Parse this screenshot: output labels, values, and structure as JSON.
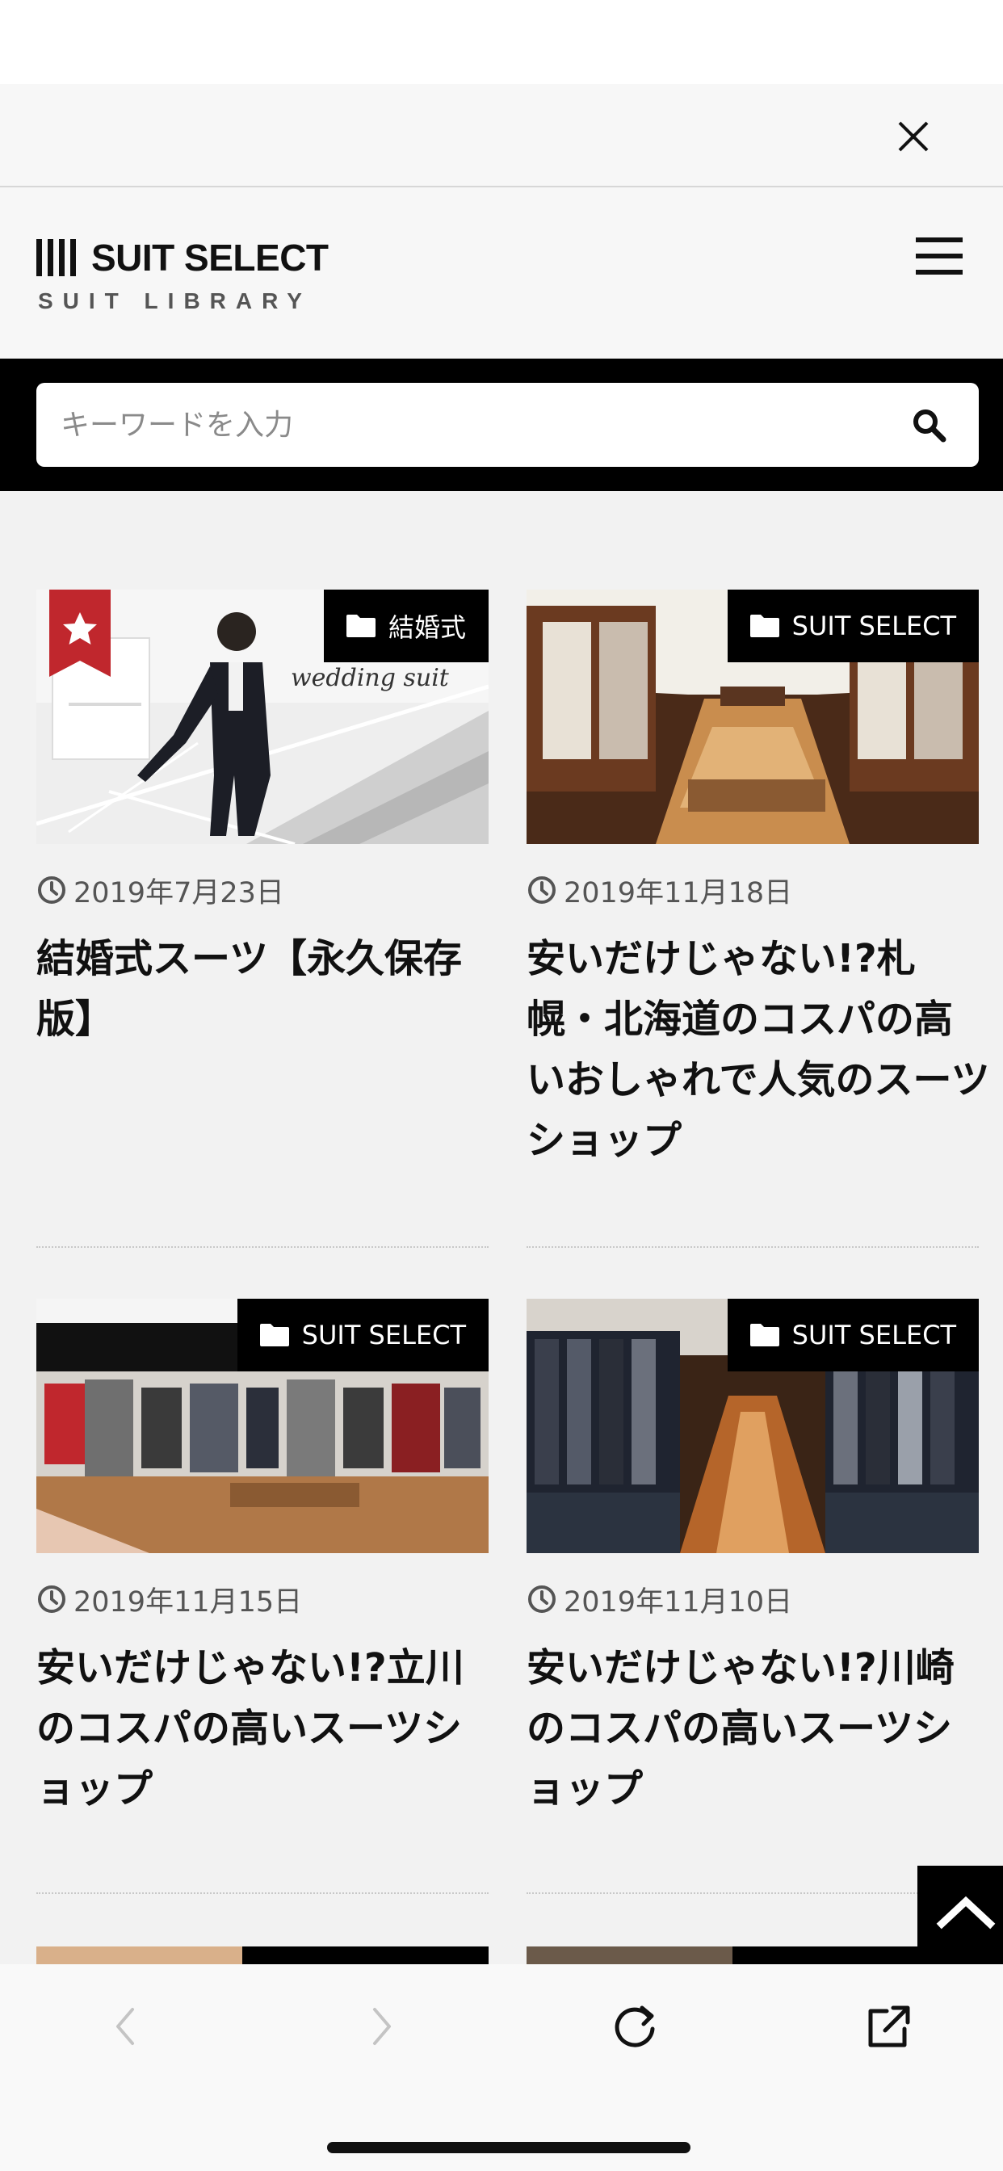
{
  "header": {
    "brand": "SUIT SELECT",
    "subtitle": "SUIT LIBRARY"
  },
  "search": {
    "placeholder": "キーワードを入力"
  },
  "articles": [
    {
      "category": "結婚式",
      "date": "2019年7月23日",
      "title": "結婚式スーツ【永久保存版】",
      "image_caption": "wedding suit",
      "featured": true
    },
    {
      "category": "SUIT SELECT",
      "date": "2019年11月18日",
      "title": "安いだけじゃない!?札幌・北海道のコスパの高いおしゃれで人気のスーツショップ"
    },
    {
      "category": "SUIT SELECT",
      "date": "2019年11月15日",
      "title": "安いだけじゃない!?立川のコスパの高いスーツショップ"
    },
    {
      "category": "SUIT SELECT",
      "date": "2019年11月10日",
      "title": "安いだけじゃない!?川崎のコスパの高いスーツショップ"
    }
  ],
  "icons": {
    "close": "close-icon",
    "menu": "hamburger-menu-icon",
    "search": "search-icon",
    "category": "folder-icon",
    "date": "clock-icon",
    "featured": "star-ribbon-icon",
    "scroll_top": "chevron-up-icon",
    "back": "chevron-left-icon",
    "forward": "chevron-right-icon",
    "reload": "reload-icon",
    "open_external": "open-in-browser-icon"
  },
  "colors": {
    "accent_red": "#c0272d",
    "bar_black": "#000000",
    "content_bg": "#f2f2f2"
  }
}
